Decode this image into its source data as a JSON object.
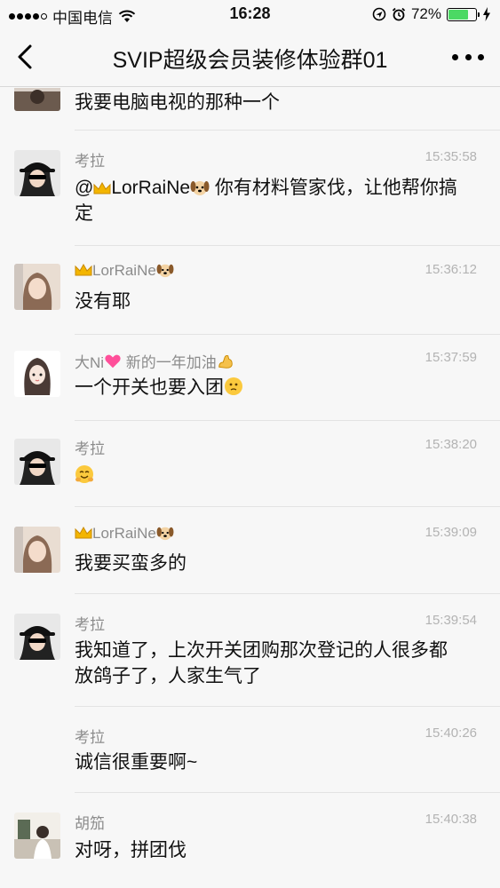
{
  "status_bar": {
    "carrier": "中国电信",
    "time": "16:28",
    "battery_text": "72%",
    "battery_level": 0.72,
    "icons": [
      "signal-dots-icon",
      "wifi-icon",
      "location-icon",
      "alarm-icon",
      "battery-icon",
      "charging-icon"
    ]
  },
  "nav": {
    "title": "SVIP超级会员装修体验群01",
    "back_icon": "chevron-left-icon",
    "more_icon": "more-dots-icon"
  },
  "colors": {
    "background": "#f7f7f7",
    "name_gray": "#8c8c8c",
    "time_gray": "#b3b3b3",
    "battery_green": "#4cd964"
  },
  "messages": [
    {
      "name": "",
      "time": "",
      "text": "我要电脑电视的那种一个",
      "avatar": "partial-avatar"
    },
    {
      "name": "考拉",
      "time": "15:35:58",
      "text_prefix": "@",
      "mention": "LorRaiNe",
      "text_suffix": " 你有材料管家伐，让他帮你搞定",
      "avatar": "koala-avatar"
    },
    {
      "name": "LorRaiNe",
      "time": "15:36:12",
      "text": "没有耶",
      "avatar": "lorraine-avatar"
    },
    {
      "name": "大Ni",
      "name_suffix": "新的一年加油",
      "time": "15:37:59",
      "text": "一个开关也要入团",
      "avatar": "dani-avatar"
    },
    {
      "name": "考拉",
      "time": "15:38:20",
      "text": "",
      "avatar": "koala-avatar"
    },
    {
      "name": "LorRaiNe",
      "time": "15:39:09",
      "text": "我要买蛮多的",
      "avatar": "lorraine-avatar"
    },
    {
      "name": "考拉",
      "time": "15:39:54",
      "text": "我知道了，上次开关团购那次登记的人很多都放鸽子了，人家生气了",
      "avatar": "koala-avatar"
    },
    {
      "name": "考拉",
      "time": "15:40:26",
      "text": "诚信很重要啊~",
      "avatar": ""
    },
    {
      "name": "胡笳",
      "time": "15:40:38",
      "text": "对呀，拼团伐",
      "avatar": "hujia-avatar"
    }
  ]
}
